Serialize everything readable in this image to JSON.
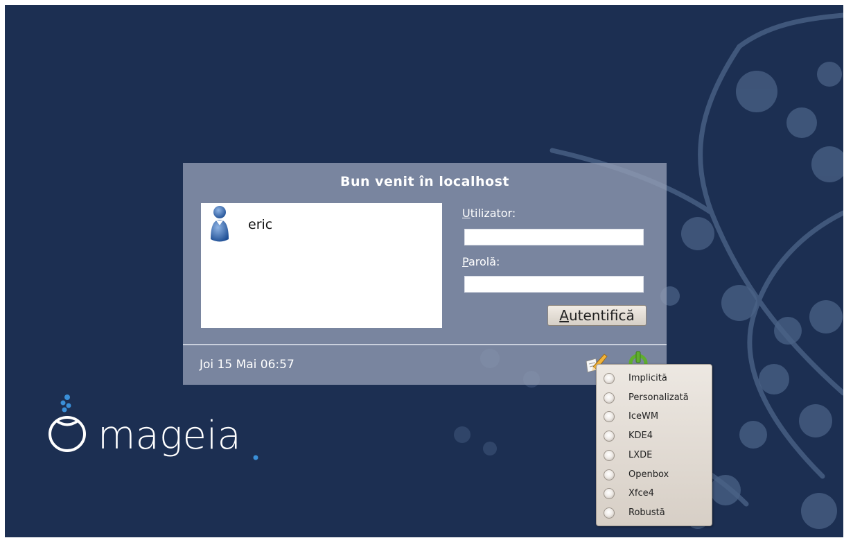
{
  "login": {
    "greeting": "Bun venit în localhost",
    "users": [
      {
        "name": "eric"
      }
    ],
    "username_label_accel": "U",
    "username_label_rest": "tilizator:",
    "password_label_accel": "P",
    "password_label_rest": "arolă:",
    "username_value": "",
    "password_value": "",
    "login_button_accel": "A",
    "login_button_rest": "utentifică",
    "clock": "Joi 15 Mai 06:57"
  },
  "session_menu": {
    "items": [
      {
        "label": "Implicită"
      },
      {
        "label": "Personalizată"
      },
      {
        "label": "IceWM"
      },
      {
        "label": "KDE4"
      },
      {
        "label": "LXDE"
      },
      {
        "label": "Openbox"
      },
      {
        "label": "Xfce4"
      },
      {
        "label": "Robustă"
      }
    ]
  },
  "logo": {
    "text": "mageia"
  },
  "colors": {
    "background": "#1c2f52",
    "panel": "#949eb5",
    "logo_accent": "#3a8fd8"
  }
}
